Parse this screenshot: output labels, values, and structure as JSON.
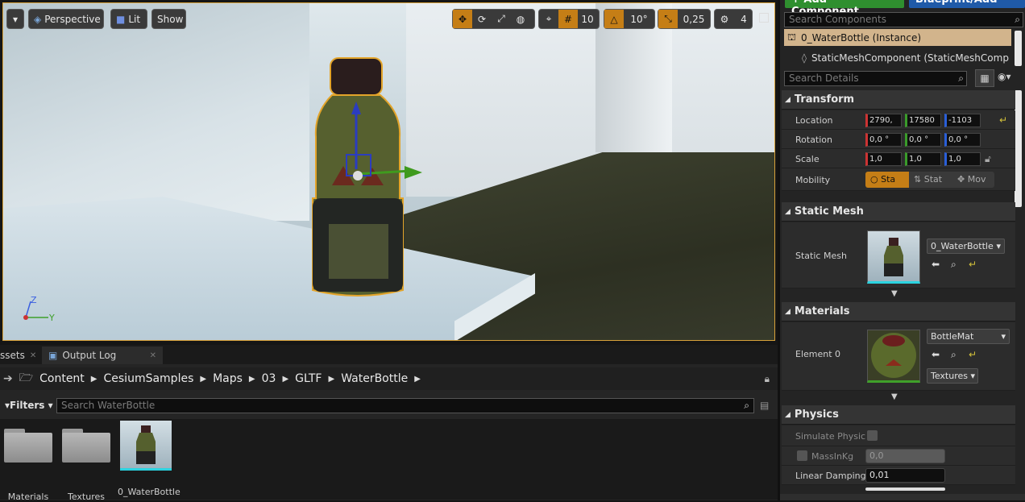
{
  "viewport": {
    "dropdown_icon": "chevron-down-icon",
    "perspective_label": "Perspective",
    "lit_label": "Lit",
    "show_label": "Show",
    "grid_snap_value": "10",
    "rotation_snap_value": "10°",
    "scale_snap_value": "0,25",
    "camera_speed_value": "4",
    "axis_labels": {
      "z": "Z",
      "y": "Y"
    },
    "selection_color": "#d8a23a"
  },
  "details": {
    "add_component_label": "+ Add Component",
    "blueprint_label": "Blueprint/Add",
    "search_components_placeholder": "Search Components",
    "components": [
      {
        "label": "0_WaterBottle (Instance)"
      },
      {
        "label": "StaticMeshComponent (StaticMeshCompone"
      }
    ],
    "search_details_placeholder": "Search Details",
    "sections": {
      "transform": "Transform",
      "static_mesh": "Static Mesh",
      "materials": "Materials",
      "physics": "Physics"
    },
    "transform": {
      "location_label": "Location",
      "location": [
        "2790,",
        "17580",
        "-1103"
      ],
      "rotation_label": "Rotation",
      "rotation": [
        "0,0 °",
        "0,0 °",
        "0,0 °"
      ],
      "scale_label": "Scale",
      "scale": [
        "1,0",
        "1,0",
        "1,0"
      ],
      "mobility_label": "Mobility",
      "mobility": [
        "Sta",
        "Stat",
        "Mov"
      ]
    },
    "static_mesh": {
      "label": "Static Mesh",
      "value": "0_WaterBottle"
    },
    "materials": {
      "element_label": "Element 0",
      "value": "BottleMat",
      "textures_label": "Textures"
    },
    "physics": {
      "simulate_label": "Simulate Physic",
      "mass_label": "MassInKg",
      "mass_value": "0,0",
      "linear_damping_label": "Linear Damping",
      "linear_damping_value": "0,01"
    }
  },
  "browser": {
    "tabs": [
      {
        "label": "ssets"
      },
      {
        "label": "Output Log"
      }
    ],
    "breadcrumb": [
      "Content",
      "CesiumSamples",
      "Maps",
      "03",
      "GLTF",
      "WaterBottle"
    ],
    "filters_label": "Filters",
    "search_placeholder": "Search WaterBottle",
    "assets": [
      {
        "label": "Materials",
        "kind": "folder"
      },
      {
        "label": "Textures",
        "kind": "folder"
      },
      {
        "label": "0_WaterBottle",
        "kind": "static-mesh"
      }
    ]
  }
}
